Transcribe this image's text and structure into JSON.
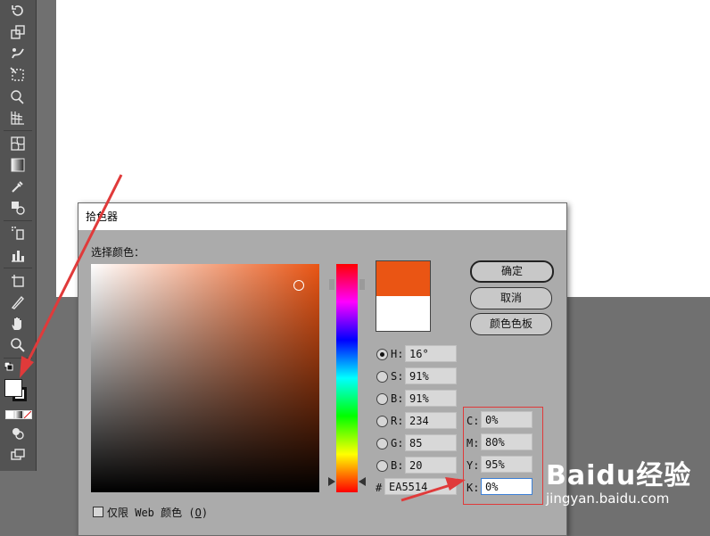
{
  "toolbar": {
    "tools": [
      "rotate-tool",
      "scale-tool",
      "warp-tool",
      "free-transform-tool",
      "shape-builder-tool",
      "perspective-grid-tool",
      "mesh-tool",
      "gradient-tool",
      "eyedropper-tool",
      "blend-tool",
      "symbol-sprayer-tool",
      "column-graph-tool",
      "artboard-tool",
      "slice-tool",
      "hand-tool",
      "zoom-tool"
    ],
    "fill_color": "#ffffff",
    "stroke_color": "#000000"
  },
  "dialog": {
    "title": "拾色器",
    "select_color_label": "选择颜色：",
    "buttons": {
      "ok": "确定",
      "cancel": "取消",
      "swatches": "颜色色板"
    },
    "new_color": "#ea5514",
    "old_color": "#ffffff",
    "fields": {
      "H": {
        "label": "H:",
        "value": "16°"
      },
      "S": {
        "label": "S:",
        "value": "91%"
      },
      "B": {
        "label": "B:",
        "value": "91%"
      },
      "R": {
        "label": "R:",
        "value": "234"
      },
      "G": {
        "label": "G:",
        "value": "85"
      },
      "Bb": {
        "label": "B:",
        "value": "20"
      },
      "C": {
        "label": "C:",
        "value": "0%"
      },
      "M": {
        "label": "M:",
        "value": "80%"
      },
      "Y": {
        "label": "Y:",
        "value": "95%"
      },
      "K": {
        "label": "K:",
        "value": "0%"
      }
    },
    "hex_label": "#",
    "hex_value": "EA5514",
    "web_only_label": "仅限 Web 颜色",
    "web_only_key": "O",
    "selected_mode": "H"
  },
  "annotation_color": "#e03a3a",
  "watermark": {
    "logo": "Baidu经验",
    "url": "jingyan.baidu.com"
  }
}
